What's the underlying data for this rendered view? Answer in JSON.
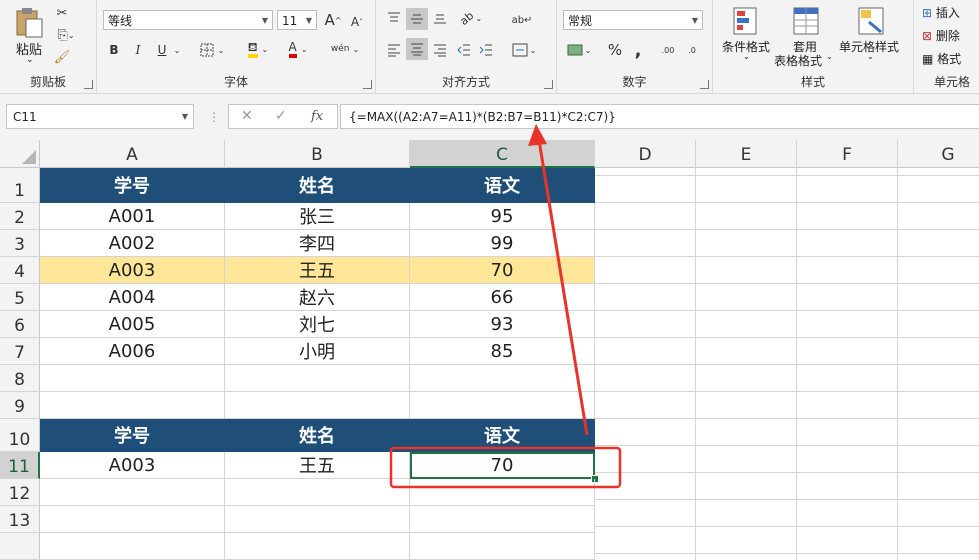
{
  "ribbon": {
    "clipboard": {
      "paste_label": "粘贴",
      "group_label": "剪贴板"
    },
    "font": {
      "font_name": "等线",
      "font_size": "11",
      "group_label": "字体",
      "grow": "A",
      "shrink": "A",
      "bold": "B",
      "italic": "I",
      "underline": "U",
      "font_color": "A",
      "phonetic": "wén"
    },
    "alignment": {
      "group_label": "对齐方式"
    },
    "number": {
      "format": "常规",
      "percent": "%",
      "comma": ",",
      "inc_decimal": ".00",
      "dec_decimal": ".0",
      "group_label": "数字"
    },
    "styles": {
      "conditional": "条件格式",
      "table_line1": "套用",
      "table_line2": "表格格式",
      "cell_styles": "单元格样式",
      "group_label": "样式"
    },
    "cells": {
      "insert": "插入",
      "delete": "删除",
      "format": "格式",
      "group_label": "单元格"
    }
  },
  "formula_bar": {
    "name_box": "C11",
    "fx": "fx",
    "cancel": "✕",
    "enter": "✓",
    "formula": "{=MAX((A2:A7=A11)*(B2:B7=B11)*C2:C7)}"
  },
  "columns": [
    "A",
    "B",
    "C",
    "D",
    "E",
    "F",
    "G"
  ],
  "rows": [
    "1",
    "2",
    "3",
    "4",
    "5",
    "6",
    "7",
    "8",
    "9",
    "10",
    "11",
    "12",
    "13"
  ],
  "table": {
    "header": [
      "学号",
      "姓名",
      "语文"
    ],
    "rows": [
      [
        "A001",
        "张三",
        "95"
      ],
      [
        "A002",
        "李四",
        "99"
      ],
      [
        "A003",
        "王五",
        "70"
      ],
      [
        "A004",
        "赵六",
        "66"
      ],
      [
        "A005",
        "刘七",
        "93"
      ],
      [
        "A006",
        "小明",
        "85"
      ]
    ]
  },
  "lookup": {
    "header": [
      "学号",
      "姓名",
      "语文"
    ],
    "row": [
      "A003",
      "王五",
      "70"
    ]
  },
  "colors": {
    "header_fill": "#1f4e78",
    "highlight_fill": "#ffe699",
    "selection": "#217346",
    "annotation": "#e8332a"
  }
}
